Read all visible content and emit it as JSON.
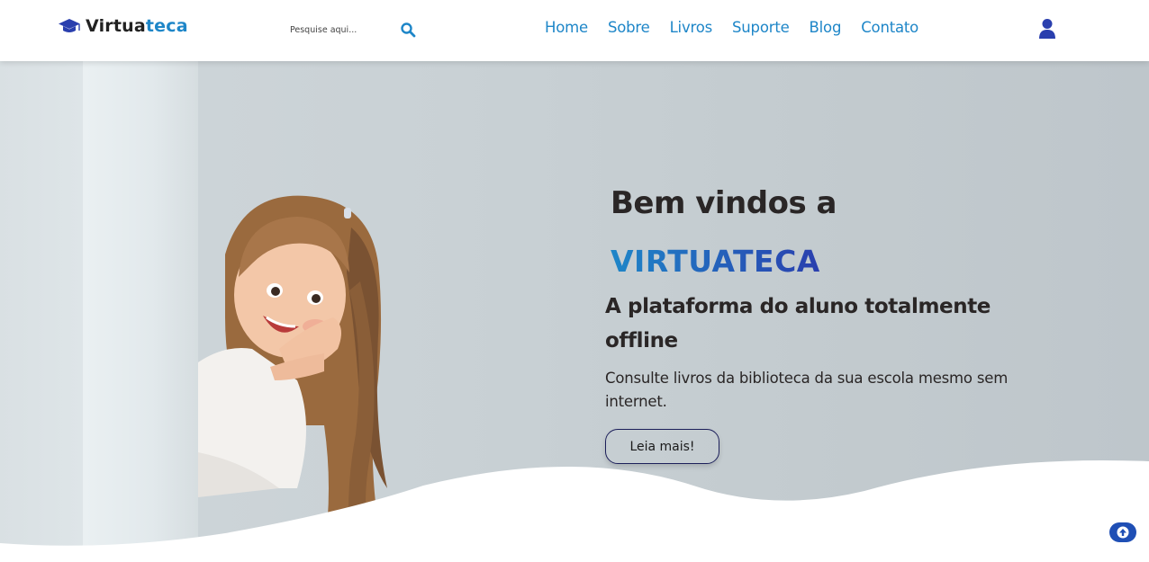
{
  "header": {
    "logo": {
      "part1": "Virtua",
      "part2": "teca",
      "icon": "graduation-cap-icon"
    },
    "search": {
      "placeholder": "Pesquise aqui...",
      "icon": "search-icon"
    },
    "nav": [
      "Home",
      "Sobre",
      "Livros",
      "Suporte",
      "Blog",
      "Contato"
    ],
    "user_icon": "user-icon"
  },
  "hero": {
    "title": "Bem vindos a",
    "brand": "VIRTUATECA",
    "subtitle": "A plataforma do aluno totalmente offline",
    "description": "Consulte livros da biblioteca da sua escola mesmo sem internet.",
    "button": "Leia mais!"
  },
  "back_to_top_icon": "arrow-up-icon",
  "colors": {
    "primary": "#1e86c8",
    "brand_gradient_end": "#2a3fae",
    "text_dark": "#2a2626",
    "button_border": "#1c1f5a",
    "back_to_top_bg": "#1f4fb5"
  }
}
